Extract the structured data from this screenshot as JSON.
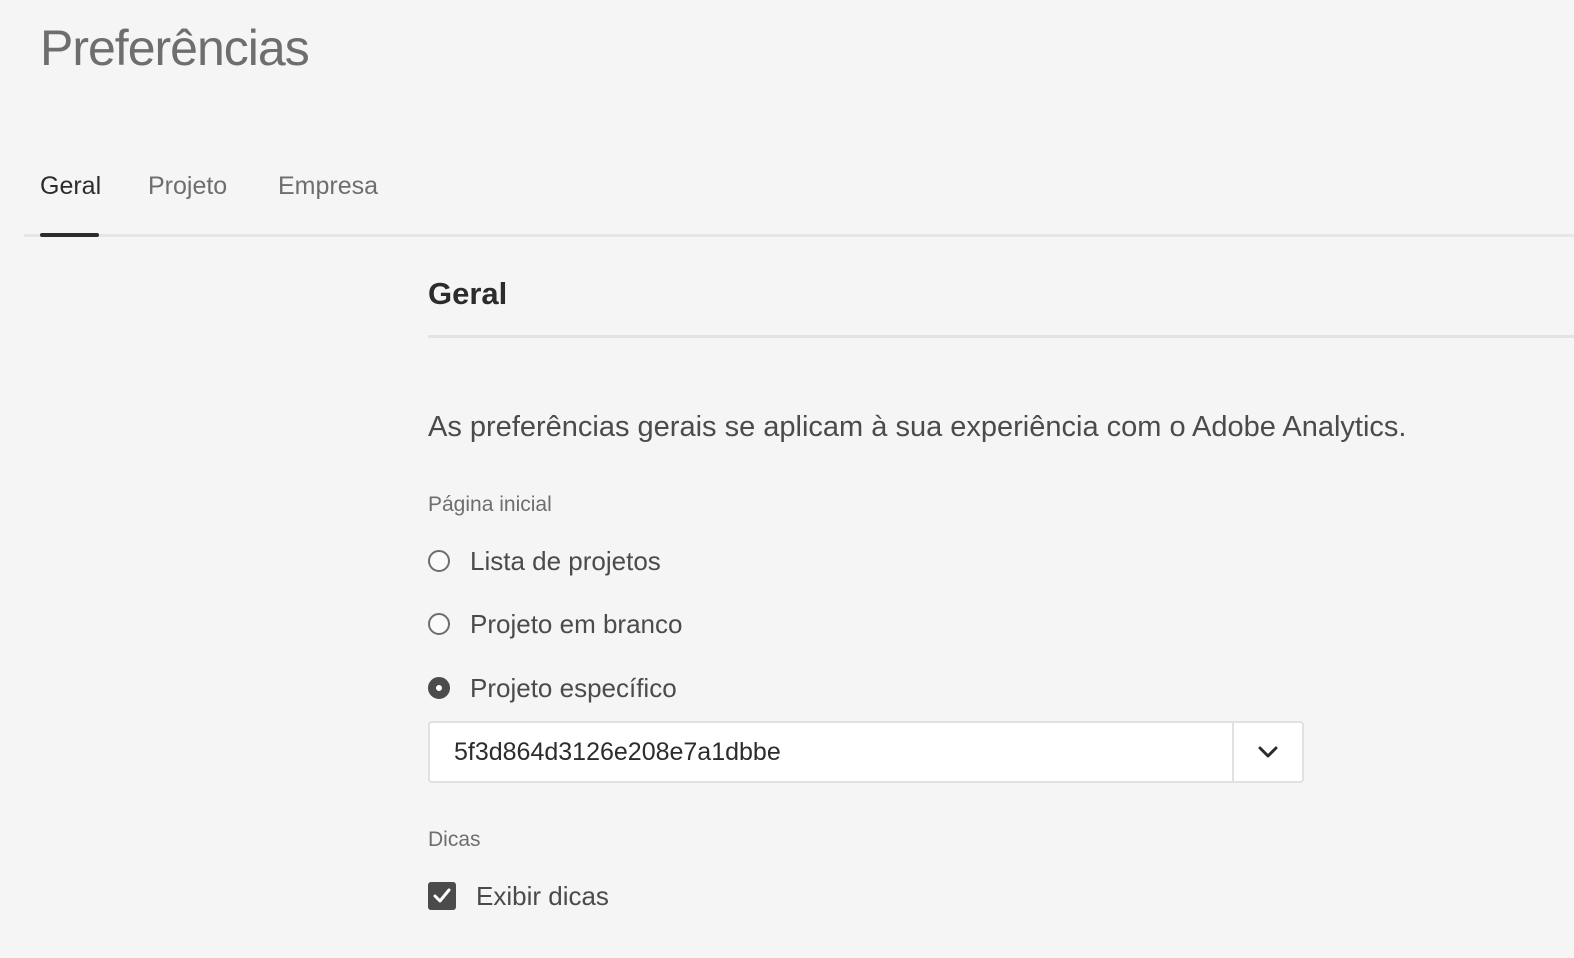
{
  "page": {
    "title": "Preferências"
  },
  "tabs": [
    {
      "label": "Geral",
      "selected": true
    },
    {
      "label": "Projeto",
      "selected": false
    },
    {
      "label": "Empresa",
      "selected": false
    }
  ],
  "section": {
    "heading": "Geral",
    "description": "As preferências gerais se aplicam à sua experiência com o Adobe Analytics."
  },
  "start_page": {
    "label": "Página inicial",
    "options": [
      {
        "label": "Lista de projetos",
        "checked": false
      },
      {
        "label": "Projeto em branco",
        "checked": false
      },
      {
        "label": "Projeto específico",
        "checked": true
      }
    ],
    "project_select": {
      "value": "5f3d864d3126e208e7a1dbbe",
      "button_icon": "chevron-down-icon"
    }
  },
  "tips": {
    "label": "Dicas",
    "checkbox_label": "Exibir dicas",
    "checked": true,
    "check_icon": "checkmark-icon"
  },
  "colors": {
    "background": "#f5f5f5",
    "text_primary": "#2c2c2c",
    "text_secondary": "#6e6e6e",
    "control_selected": "#4b4b4b"
  }
}
